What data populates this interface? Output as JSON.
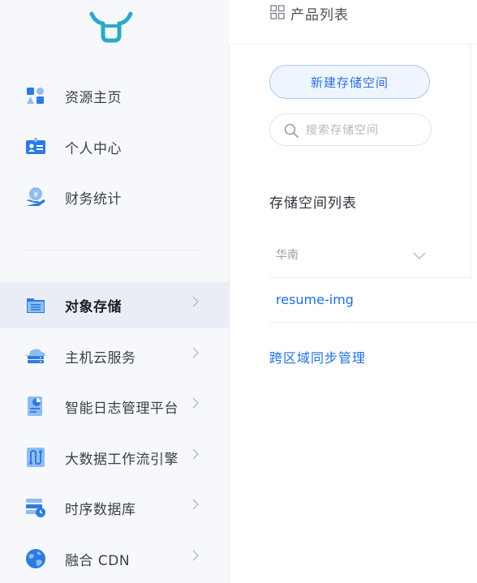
{
  "sidebar": {
    "items": [
      {
        "label": "资源主页",
        "icon": "resource-home-icon"
      },
      {
        "label": "个人中心",
        "icon": "id-card-icon"
      },
      {
        "label": "财务统计",
        "icon": "finance-icon"
      },
      {
        "label": "对象存储",
        "icon": "folder-icon"
      },
      {
        "label": "主机云服务",
        "icon": "cloud-server-icon"
      },
      {
        "label": "智能日志管理平台",
        "icon": "log-report-icon"
      },
      {
        "label": "大数据工作流引擎",
        "icon": "workflow-icon"
      },
      {
        "label": "时序数据库",
        "icon": "timeseries-db-icon"
      },
      {
        "label": "融合 CDN",
        "icon": "globe-icon"
      }
    ]
  },
  "topbar": {
    "title": "产品列表"
  },
  "main": {
    "new_bucket_label": "新建存储空间",
    "search_placeholder": "搜索存储空间",
    "list_title": "存储空间列表",
    "region_value": "华南",
    "bucket_name": "resume-img",
    "sync_link": "跨区域同步管理"
  },
  "colors": {
    "accent": "#1e6fe0",
    "icon_blue": "#2d7be0"
  }
}
